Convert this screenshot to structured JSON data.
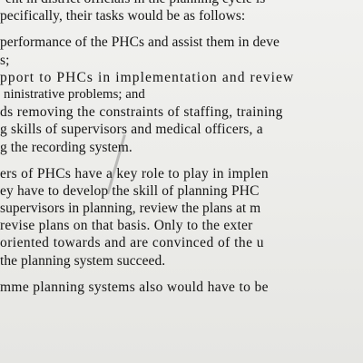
{
  "document": {
    "lines": [
      "ent in district officials in the planning cycle is",
      "pecifically, their tasks would be as follows:",
      "performance of the PHCs and assist them in deve",
      "s;",
      "pport to PHCs in implementation and review",
      "ninistrative problems; and",
      "ds removing the constraints of staffing, training",
      "g skills of supervisors and medical officers, a",
      "g the recording system.",
      "ers of PHCs have a key role to play in implen",
      "ey have to develop the skill of planning PHC",
      "supervisors in planning, review the plans at m",
      "revise plans on that basis. Only to the exter",
      "oriented towards and are convinced of the u",
      "the planning system succeed.",
      "mme planning systems also would have to be"
    ]
  }
}
